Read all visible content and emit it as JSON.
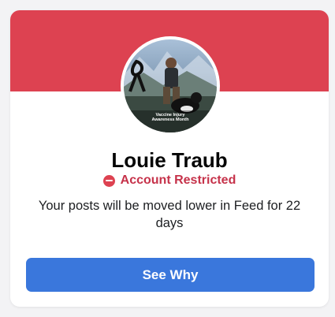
{
  "profile": {
    "name": "Louie Traub",
    "avatar_caption_line1": "Vaccine Injury",
    "avatar_caption_line2": "Awareness Month"
  },
  "status": {
    "icon": "minus-circle-icon",
    "label": "Account Restricted"
  },
  "message": "Your posts will be moved lower in Feed for 22 days",
  "actions": {
    "see_why_label": "See Why"
  },
  "colors": {
    "banner": "#dd4251",
    "status_text": "#c6324a",
    "button": "#3a77dc"
  }
}
